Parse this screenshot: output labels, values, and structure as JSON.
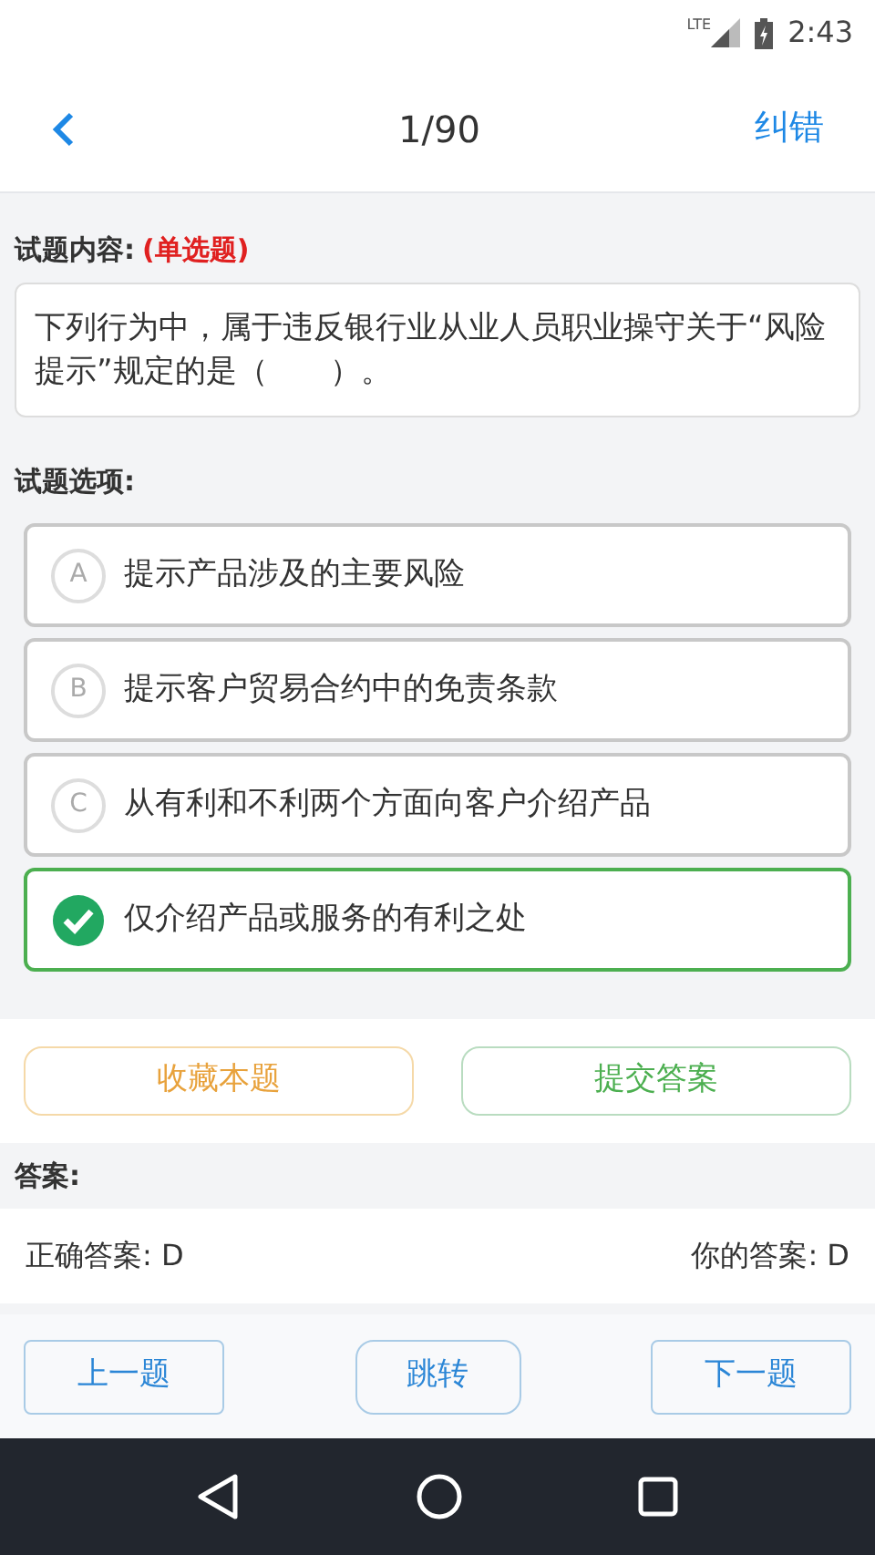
{
  "status_bar": {
    "network": "LTE",
    "time": "2:43"
  },
  "header": {
    "title": "1/90",
    "action": "纠错"
  },
  "question": {
    "label": "试题内容:",
    "type": "(单选题)",
    "text": "下列行为中，属于违反银行业从业人员职业操守关于“风险提示”规定的是（　　）。"
  },
  "options_label": "试题选项:",
  "options": [
    {
      "letter": "A",
      "text": "提示产品涉及的主要风险",
      "selected": false
    },
    {
      "letter": "B",
      "text": "提示客户贸易合约中的免责条款",
      "selected": false
    },
    {
      "letter": "C",
      "text": "从有利和不利两个方面向客户介绍产品",
      "selected": false
    },
    {
      "text": "仅介绍产品或服务的有利之处",
      "selected": true
    }
  ],
  "actions": {
    "favorite": "收藏本题",
    "submit": "提交答案"
  },
  "answer": {
    "label": "答案:",
    "correct": "正确答案: D",
    "yours": "你的答案: D"
  },
  "navigation": {
    "previous": "上一题",
    "jump": "跳转",
    "next": "下一题"
  }
}
